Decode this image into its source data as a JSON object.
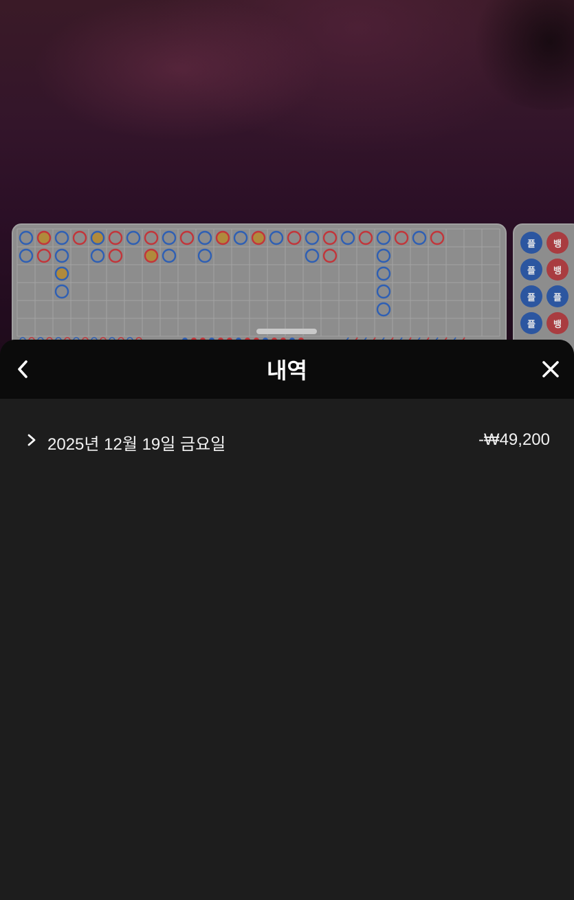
{
  "background": {
    "side_chips": [
      {
        "left": "플",
        "right": "뱅"
      },
      {
        "left": "플",
        "right": "뱅"
      },
      {
        "left": "플",
        "right": "플"
      },
      {
        "left": "플",
        "right": "뱅"
      }
    ]
  },
  "sheet": {
    "title": "내역",
    "back_icon": "chevron-left-icon",
    "close_icon": "close-icon"
  },
  "history": {
    "items": [
      {
        "date": "2025년 12월 19일 금요일",
        "amount": "-₩49,200",
        "expanded": false
      }
    ]
  },
  "colors": {
    "header_bg": "#0b0b0b",
    "sheet_bg": "#1d1d1d",
    "text": "#f2f2f2",
    "road_blue": "#2e5fb4",
    "road_red": "#c2353a"
  }
}
